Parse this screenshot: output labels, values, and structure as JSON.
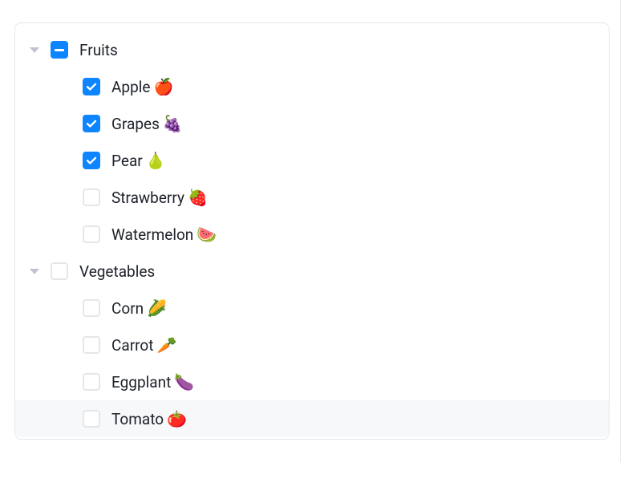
{
  "tree": [
    {
      "id": "fruits",
      "label": "Fruits",
      "emoji": "",
      "state": "indeterminate",
      "expanded": true,
      "highlight": false,
      "children": [
        {
          "id": "apple",
          "label": "Apple",
          "emoji": "🍎",
          "state": "checked",
          "highlight": false
        },
        {
          "id": "grapes",
          "label": "Grapes",
          "emoji": "🍇",
          "state": "checked",
          "highlight": false
        },
        {
          "id": "pear",
          "label": "Pear",
          "emoji": "🍐",
          "state": "checked",
          "highlight": false
        },
        {
          "id": "strawberry",
          "label": "Strawberry",
          "emoji": "🍓",
          "state": "unchecked",
          "highlight": false
        },
        {
          "id": "watermelon",
          "label": "Watermelon",
          "emoji": "🍉",
          "state": "unchecked",
          "highlight": false
        }
      ]
    },
    {
      "id": "vegetables",
      "label": "Vegetables",
      "emoji": "",
      "state": "unchecked",
      "expanded": true,
      "highlight": false,
      "children": [
        {
          "id": "corn",
          "label": "Corn",
          "emoji": "🌽",
          "state": "unchecked",
          "highlight": false
        },
        {
          "id": "carrot",
          "label": "Carrot",
          "emoji": "🥕",
          "state": "unchecked",
          "highlight": false
        },
        {
          "id": "eggplant",
          "label": "Eggplant",
          "emoji": "🍆",
          "state": "unchecked",
          "highlight": false
        },
        {
          "id": "tomato",
          "label": "Tomato",
          "emoji": "🍅",
          "state": "unchecked",
          "highlight": true
        }
      ]
    }
  ]
}
